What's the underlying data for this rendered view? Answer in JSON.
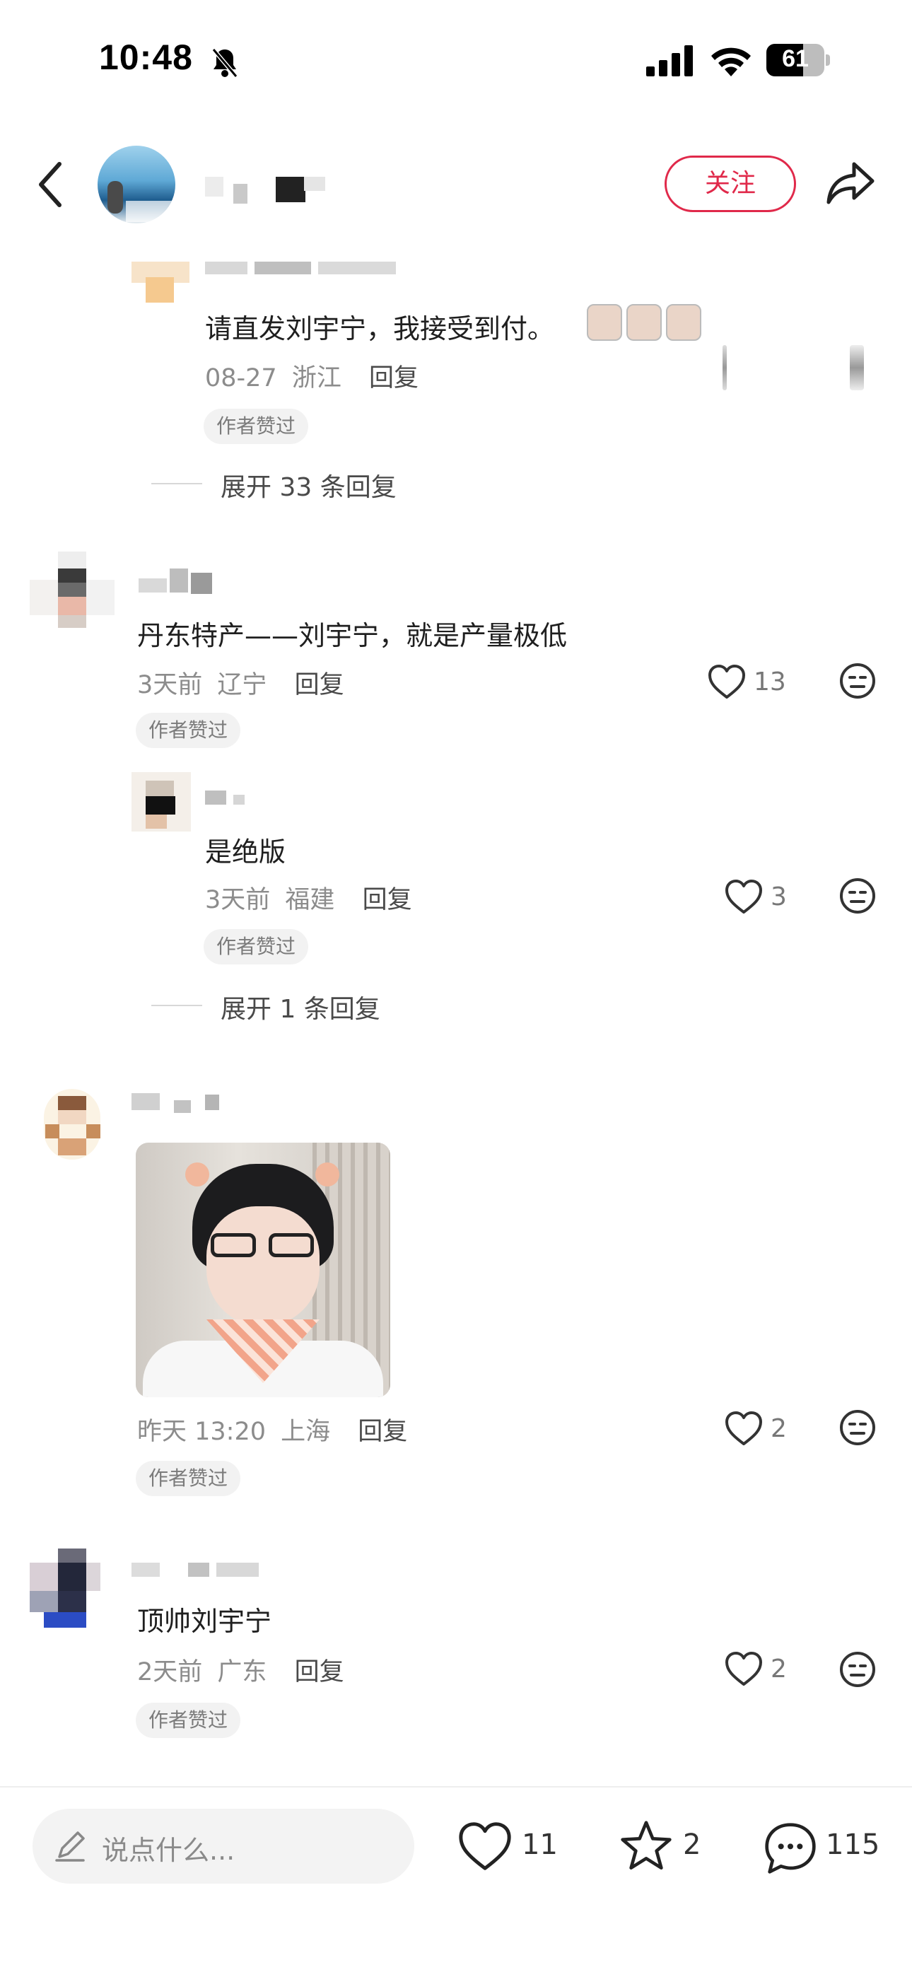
{
  "status_bar": {
    "time": "10:48",
    "battery": "61"
  },
  "header": {
    "follow_label": "关注"
  },
  "comments": [
    {
      "text": "请直发刘宇宁，我接受到付。",
      "date": "08-27",
      "region": "浙江",
      "reply_label": "回复",
      "badge": "作者赞过",
      "expand": "展开 33 条回复"
    },
    {
      "text": "丹东特产——刘宇宁，就是产量极低",
      "date": "3天前",
      "region": "辽宁",
      "reply_label": "回复",
      "likes": "13",
      "badge": "作者赞过"
    },
    {
      "text": "是绝版",
      "date": "3天前",
      "region": "福建",
      "reply_label": "回复",
      "likes": "3",
      "badge": "作者赞过",
      "expand": "展开 1 条回复"
    },
    {
      "date": "昨天 13:20",
      "region": "上海",
      "reply_label": "回复",
      "likes": "2",
      "badge": "作者赞过"
    },
    {
      "text": "顶帅刘宇宁",
      "date": "2天前",
      "region": "广东",
      "reply_label": "回复",
      "likes": "2",
      "badge": "作者赞过"
    }
  ],
  "bottom_bar": {
    "input_placeholder": "说点什么...",
    "likes": "11",
    "favorites": "2",
    "comments": "115"
  },
  "icons": {
    "back": "chevron-left-icon",
    "share": "share-icon",
    "heart": "heart-icon",
    "emoji": "emoji-icon",
    "pencil": "pencil-icon",
    "star": "star-icon",
    "chat": "chat-bubble-icon"
  },
  "colors": {
    "accent": "#e0294a",
    "text": "#1f1f1f",
    "meta": "#8c8c8c"
  }
}
